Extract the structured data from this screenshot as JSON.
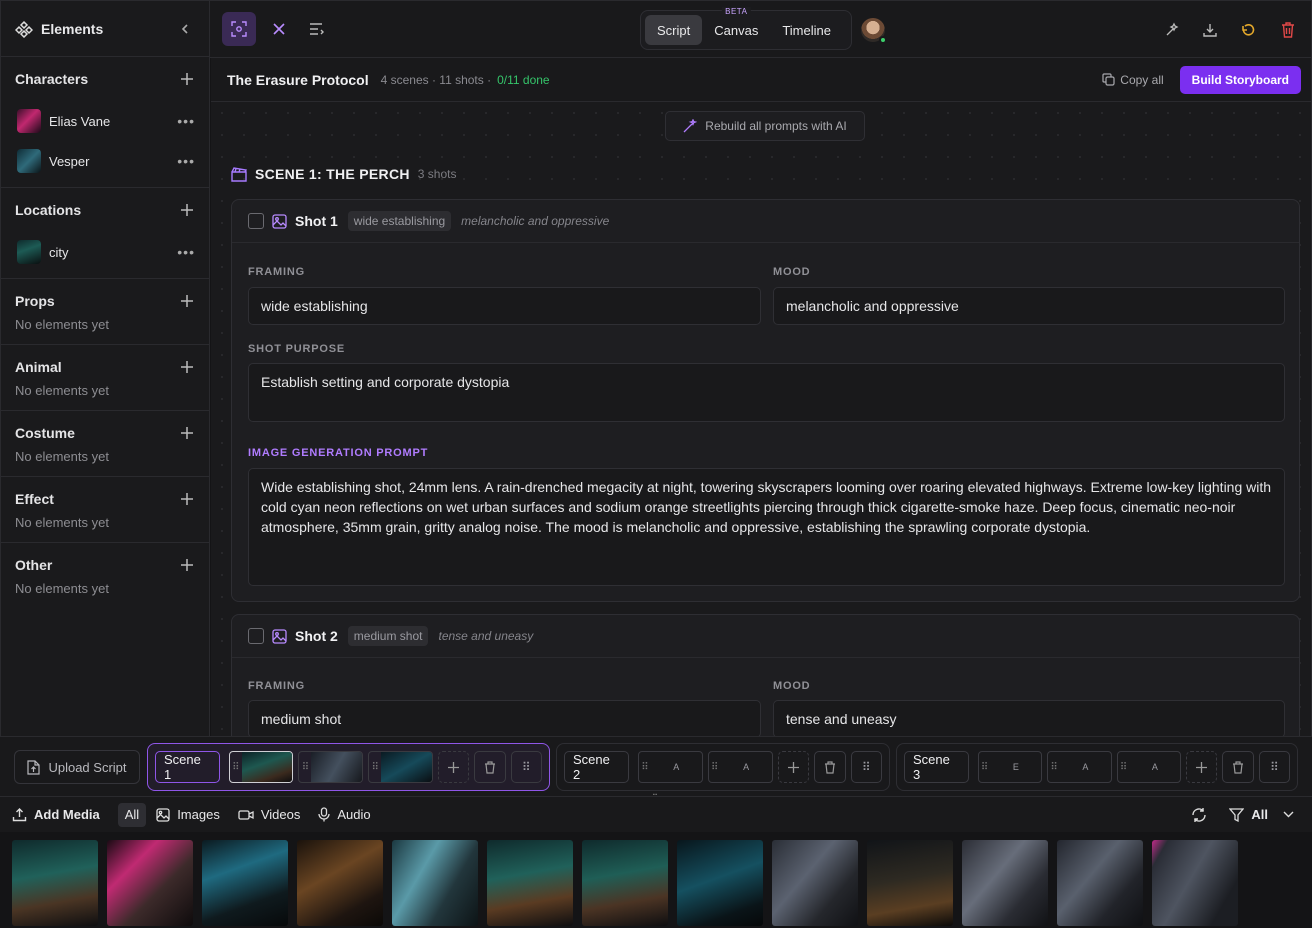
{
  "sidebar": {
    "title": "Elements",
    "sections": [
      {
        "label": "Characters",
        "items": [
          "Elias Vane",
          "Vesper"
        ]
      },
      {
        "label": "Locations",
        "items": [
          "city"
        ]
      },
      {
        "label": "Props",
        "empty": "No elements yet"
      },
      {
        "label": "Animal",
        "empty": "No elements yet"
      },
      {
        "label": "Costume",
        "empty": "No elements yet"
      },
      {
        "label": "Effect",
        "empty": "No elements yet"
      },
      {
        "label": "Other",
        "empty": "No elements yet"
      }
    ]
  },
  "topbar": {
    "tabs": [
      "Script",
      "Canvas",
      "Timeline"
    ],
    "active_tab": "Script",
    "beta_badge": "BETA"
  },
  "project": {
    "title": "The Erasure Protocol",
    "meta": "4 scenes · 11 shots ·",
    "done": "0/11 done",
    "copy_all": "Copy all",
    "build": "Build Storyboard"
  },
  "main": {
    "rebuild": "Rebuild all prompts with AI",
    "scene_title": "SCENE 1: THE PERCH",
    "scene_count": "3 shots",
    "labels": {
      "framing": "FRAMING",
      "mood": "MOOD",
      "purpose": "SHOT PURPOSE",
      "prompt": "IMAGE GENERATION PROMPT"
    },
    "shots": [
      {
        "title": "Shot 1",
        "chip": "wide establishing",
        "mood_tag": "melancholic and oppressive",
        "framing": "wide establishing",
        "mood": "melancholic and oppressive",
        "purpose": "Establish setting and corporate dystopia",
        "prompt": "Wide establishing shot, 24mm lens. A rain-drenched megacity at night, towering skyscrapers looming over roaring elevated highways. Extreme low-key lighting with cold cyan neon reflections on wet urban surfaces and sodium orange streetlights piercing through thick cigarette-smoke haze. Deep focus, cinematic neo-noir atmosphere, 35mm grain, gritty analog noise. The mood is melancholic and oppressive, establishing the sprawling corporate dystopia."
      },
      {
        "title": "Shot 2",
        "chip": "medium shot",
        "mood_tag": "tense and uneasy",
        "framing": "medium shot",
        "mood": "tense and uneasy"
      }
    ]
  },
  "strip": {
    "upload": "Upload Script",
    "scenes": [
      {
        "name": "Scene 1",
        "shots": [
          "",
          "",
          ""
        ]
      },
      {
        "name": "Scene 2",
        "shots": [
          "A",
          "A"
        ]
      },
      {
        "name": "Scene 3",
        "shots": [
          "E",
          "A",
          "A"
        ]
      }
    ]
  },
  "media": {
    "add": "Add Media",
    "filters": [
      "All",
      "Images",
      "Videos",
      "Audio"
    ],
    "active_filter": "All",
    "right_filter": "All"
  },
  "colors": {
    "accent": "#7b2ff0",
    "accent_light": "#b07cff",
    "done_green": "#35c46a"
  }
}
